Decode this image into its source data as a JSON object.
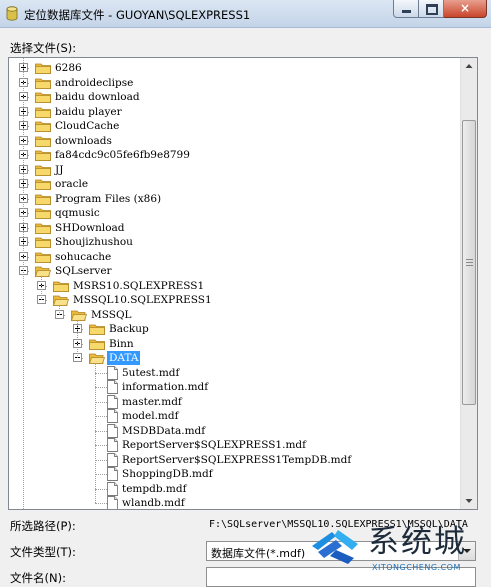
{
  "window": {
    "title": "定位数据库文件 - GUOYAN\\SQLEXPRESS1",
    "close_symbol": "×"
  },
  "labels": {
    "select_file": "选择文件(S):",
    "selected_path": "所选路径(P):",
    "file_type": "文件类型(T):",
    "file_name": "文件名(N):"
  },
  "tree": [
    {
      "label": "6286",
      "depth": 0,
      "kind": "folder",
      "expander": "plus"
    },
    {
      "label": "androideclipse",
      "depth": 0,
      "kind": "folder",
      "expander": "plus"
    },
    {
      "label": "baidu download",
      "depth": 0,
      "kind": "folder",
      "expander": "plus"
    },
    {
      "label": "baidu player",
      "depth": 0,
      "kind": "folder",
      "expander": "plus"
    },
    {
      "label": "CloudCache",
      "depth": 0,
      "kind": "folder",
      "expander": "plus"
    },
    {
      "label": "downloads",
      "depth": 0,
      "kind": "folder",
      "expander": "plus"
    },
    {
      "label": "fa84cdc9c05fe6fb9e8799",
      "depth": 0,
      "kind": "folder",
      "expander": "plus"
    },
    {
      "label": "JJ",
      "depth": 0,
      "kind": "folder",
      "expander": "plus"
    },
    {
      "label": "oracle",
      "depth": 0,
      "kind": "folder",
      "expander": "plus"
    },
    {
      "label": "Program Files (x86)",
      "depth": 0,
      "kind": "folder",
      "expander": "plus"
    },
    {
      "label": "qqmusic",
      "depth": 0,
      "kind": "folder",
      "expander": "plus"
    },
    {
      "label": "SHDownload",
      "depth": 0,
      "kind": "folder",
      "expander": "plus"
    },
    {
      "label": "Shoujizhushou",
      "depth": 0,
      "kind": "folder",
      "expander": "plus"
    },
    {
      "label": "sohucache",
      "depth": 0,
      "kind": "folder",
      "expander": "plus"
    },
    {
      "label": "SQLserver",
      "depth": 0,
      "kind": "folder",
      "expander": "minus"
    },
    {
      "label": "MSRS10.SQLEXPRESS1",
      "depth": 1,
      "kind": "folder",
      "expander": "plus"
    },
    {
      "label": "MSSQL10.SQLEXPRESS1",
      "depth": 1,
      "kind": "folder",
      "expander": "minus"
    },
    {
      "label": "MSSQL",
      "depth": 2,
      "kind": "folder",
      "expander": "minus"
    },
    {
      "label": "Backup",
      "depth": 3,
      "kind": "folder",
      "expander": "plus"
    },
    {
      "label": "Binn",
      "depth": 3,
      "kind": "folder",
      "expander": "plus"
    },
    {
      "label": "DATA",
      "depth": 3,
      "kind": "folder",
      "expander": "minus",
      "selected": true
    },
    {
      "label": "5utest.mdf",
      "depth": 4,
      "kind": "file"
    },
    {
      "label": "information.mdf",
      "depth": 4,
      "kind": "file"
    },
    {
      "label": "master.mdf",
      "depth": 4,
      "kind": "file"
    },
    {
      "label": "model.mdf",
      "depth": 4,
      "kind": "file"
    },
    {
      "label": "MSDBData.mdf",
      "depth": 4,
      "kind": "file"
    },
    {
      "label": "ReportServer$SQLEXPRESS1.mdf",
      "depth": 4,
      "kind": "file"
    },
    {
      "label": "ReportServer$SQLEXPRESS1TempDB.mdf",
      "depth": 4,
      "kind": "file"
    },
    {
      "label": "ShoppingDB.mdf",
      "depth": 4,
      "kind": "file"
    },
    {
      "label": "tempdb.mdf",
      "depth": 4,
      "kind": "file"
    },
    {
      "label": "wlandb.mdf",
      "depth": 4,
      "kind": "file"
    }
  ],
  "fields": {
    "selected_path_value": "F:\\SQLserver\\MSSQL10.SQLEXPRESS1\\MSSQL\\DATA",
    "file_type_value": "数据库文件(*.mdf)",
    "file_name_value": ""
  },
  "watermark": {
    "title": "系统城",
    "url": "XITONGCHENG.COM"
  },
  "colors": {
    "selection": "#3399ff",
    "folder": "#f2c94c",
    "watermark_blue": "#1d6fb6"
  }
}
